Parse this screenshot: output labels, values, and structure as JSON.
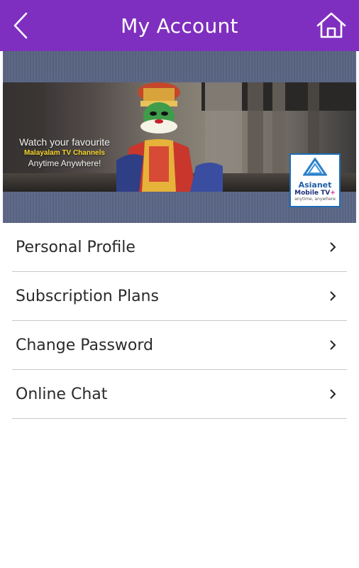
{
  "header": {
    "title": "My Account",
    "back_icon": "back-arrow-icon",
    "home_icon": "home-icon",
    "bg_color": "#7f2fbf"
  },
  "banner": {
    "tagline_line1": "Watch your favourite",
    "tagline_line2": "Malayalam TV Channels",
    "tagline_line3": "Anytime Anywhere!",
    "logo_name": "Asianet",
    "logo_sub": "Mobile TV",
    "logo_plus": "+",
    "logo_tagline": "anytime, anywhere"
  },
  "menu": {
    "items": [
      {
        "label": "Personal Profile"
      },
      {
        "label": "Subscription Plans"
      },
      {
        "label": "Change Password"
      },
      {
        "label": "Online Chat"
      }
    ],
    "chevron_icon": "chevron-right-icon"
  }
}
